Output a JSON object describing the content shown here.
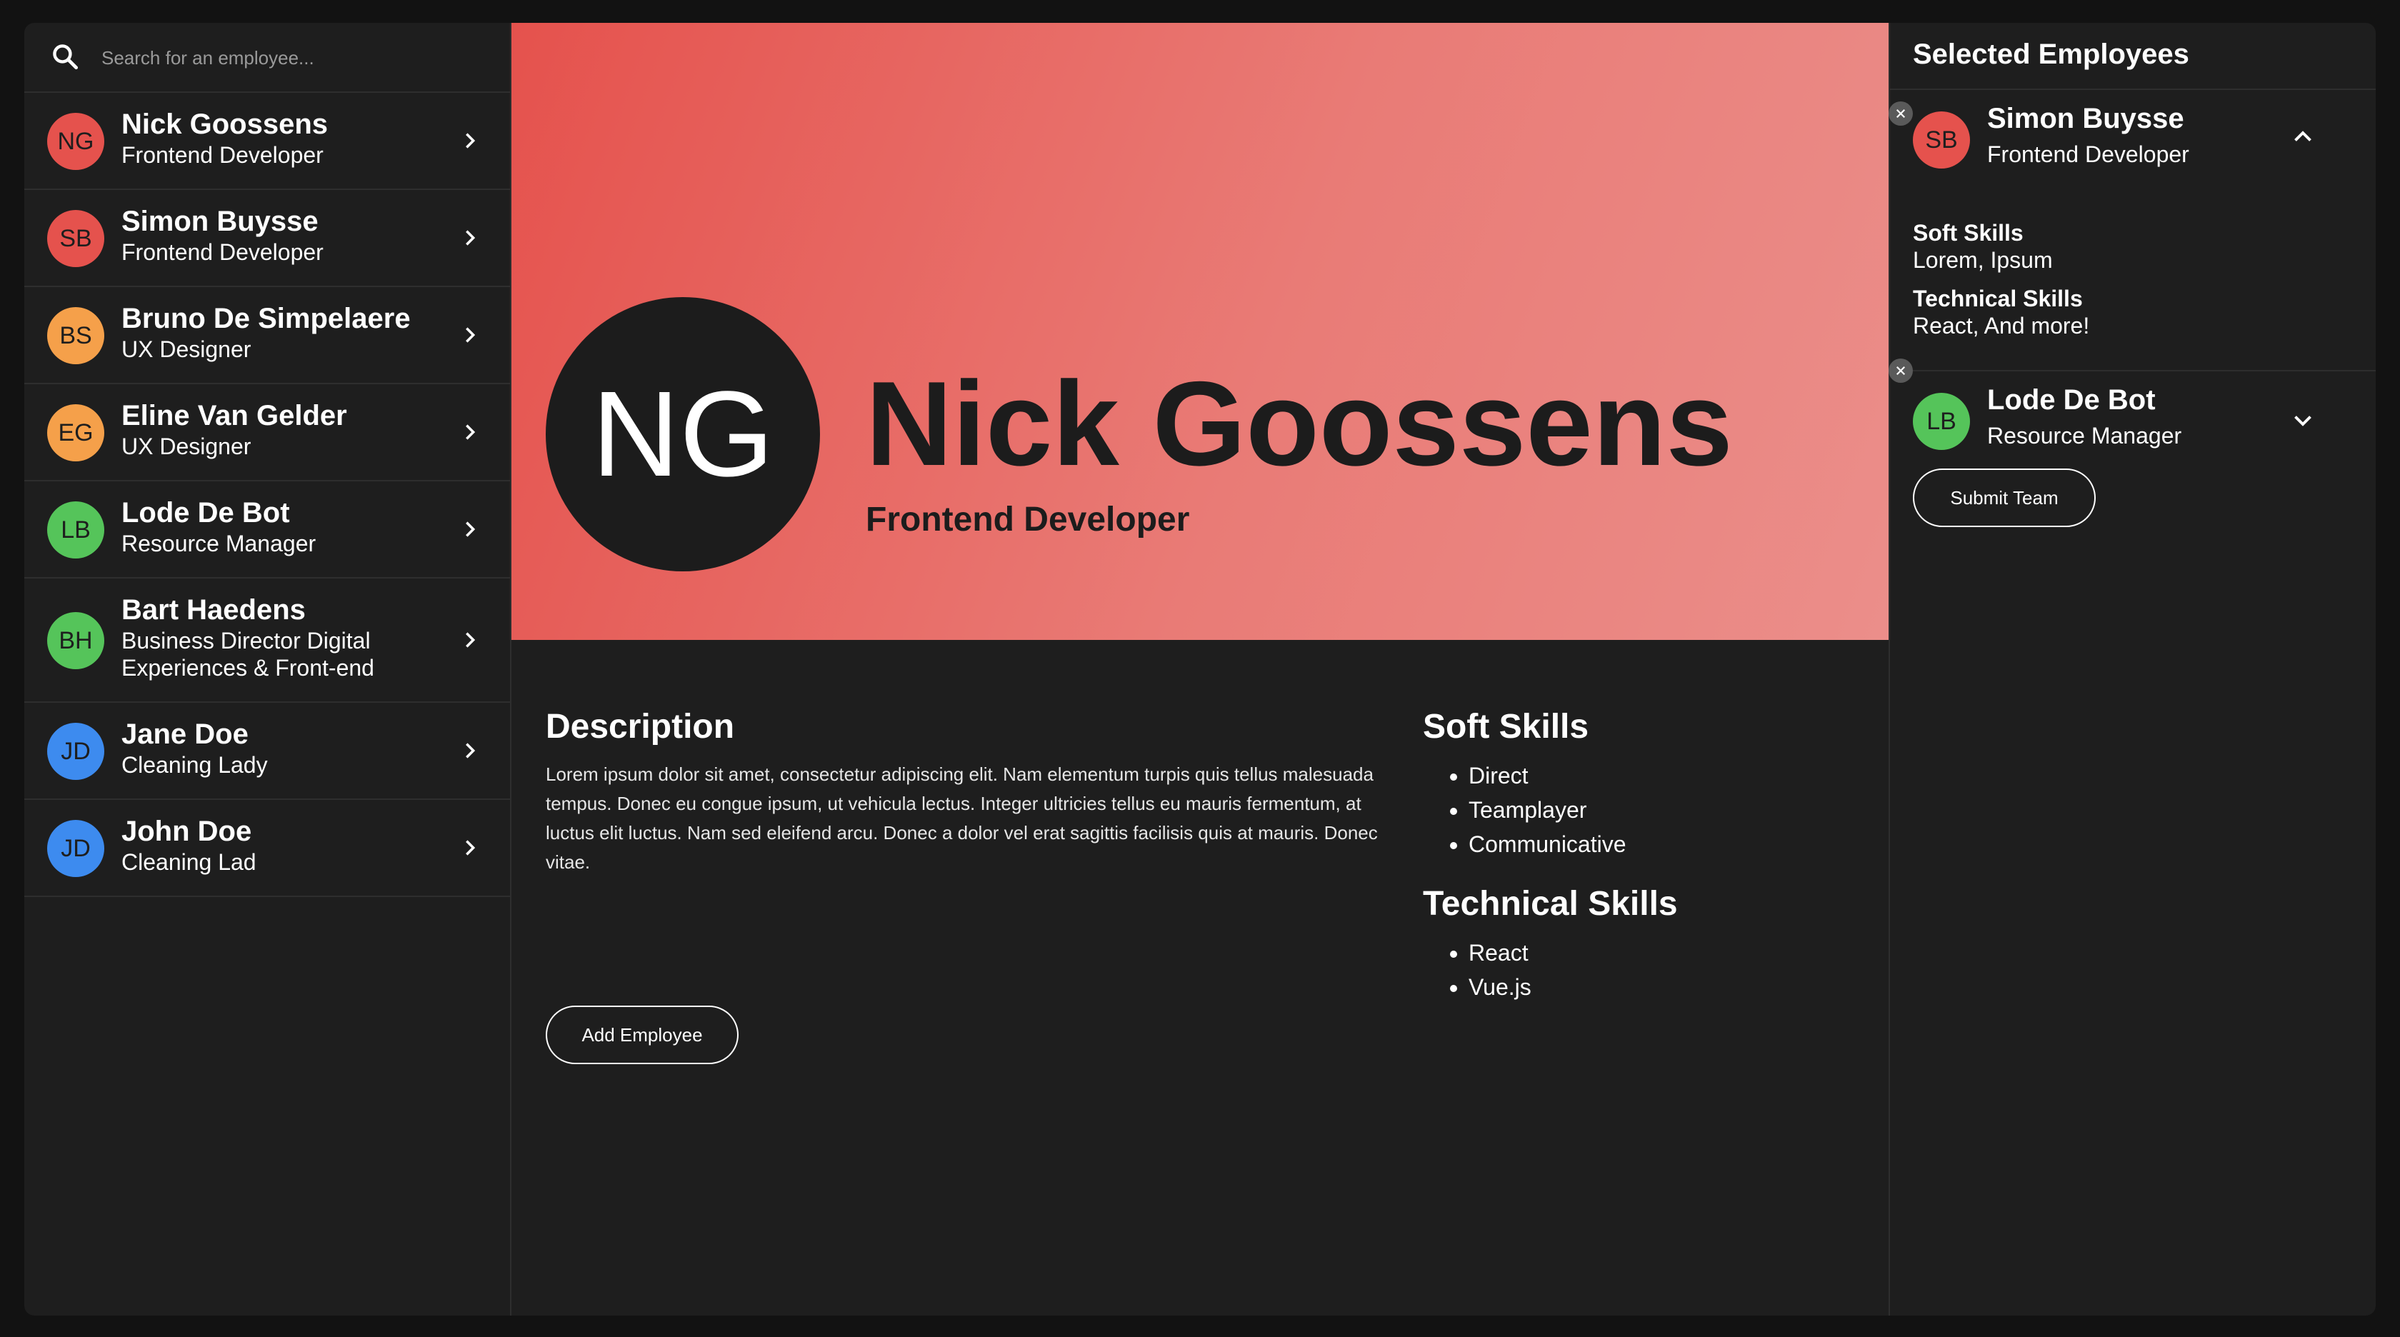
{
  "search": {
    "placeholder": "Search for an employee..."
  },
  "colors": {
    "red": "#e5524d",
    "orange": "#f5a04a",
    "green": "#55c45a",
    "blue": "#3d8bef",
    "hero_gradient_start": "#e5524d",
    "hero_gradient_end": "#eb8e8a"
  },
  "employees": [
    {
      "initials": "NG",
      "name": "Nick Goossens",
      "role": "Frontend Developer",
      "color": "#e5524d"
    },
    {
      "initials": "SB",
      "name": "Simon Buysse",
      "role": "Frontend Developer",
      "color": "#e5524d"
    },
    {
      "initials": "BS",
      "name": "Bruno De Simpelaere",
      "role": "UX Designer",
      "color": "#f5a04a"
    },
    {
      "initials": "EG",
      "name": "Eline Van Gelder",
      "role": "UX Designer",
      "color": "#f5a04a"
    },
    {
      "initials": "LB",
      "name": "Lode De Bot",
      "role": "Resource Manager",
      "color": "#55c45a"
    },
    {
      "initials": "BH",
      "name": "Bart Haedens",
      "role": "Business Director Digital Experiences & Front-end",
      "color": "#55c45a"
    },
    {
      "initials": "JD",
      "name": "Jane Doe",
      "role": "Cleaning Lady",
      "color": "#3d8bef"
    },
    {
      "initials": "JD",
      "name": "John Doe",
      "role": "Cleaning Lad",
      "color": "#3d8bef"
    }
  ],
  "detail": {
    "initials": "NG",
    "name": "Nick Goossens",
    "role": "Frontend Developer",
    "description_title": "Description",
    "description": "Lorem ipsum dolor sit amet, consectetur adipiscing elit. Nam elementum turpis quis tellus malesuada tempus. Donec eu congue ipsum, ut vehicula lectus. Integer ultricies tellus eu mauris fermentum, at luctus elit luctus. Nam sed eleifend arcu. Donec a dolor vel erat sagittis facilisis quis at mauris. Donec vitae.",
    "soft_skills_title": "Soft Skills",
    "soft_skills": [
      "Direct",
      "Teamplayer",
      "Communicative"
    ],
    "technical_skills_title": "Technical Skills",
    "technical_skills": [
      "React",
      "Vue.js"
    ],
    "add_button": "Add Employee"
  },
  "selected": {
    "title": "Selected Employees",
    "items": [
      {
        "initials": "SB",
        "name": "Simon Buysse",
        "role": "Frontend Developer",
        "color": "#e5524d",
        "expanded": true,
        "soft_label": "Soft Skills",
        "soft_value": "Lorem, Ipsum",
        "tech_label": "Technical Skills",
        "tech_value": "React, And more!"
      },
      {
        "initials": "LB",
        "name": "Lode De Bot",
        "role": "Resource Manager",
        "color": "#55c45a",
        "expanded": false
      }
    ],
    "submit_button": "Submit Team"
  }
}
